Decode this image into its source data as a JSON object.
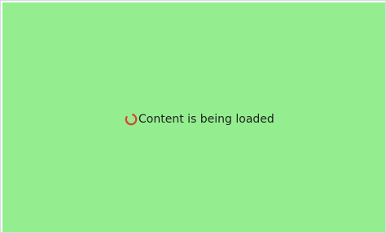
{
  "loading": {
    "message": "Content is being loaded",
    "icon": "loading-spinner-icon"
  },
  "colors": {
    "panel_background": "#94ee90",
    "spinner": "#d8432f",
    "text": "#1f1f1f"
  }
}
